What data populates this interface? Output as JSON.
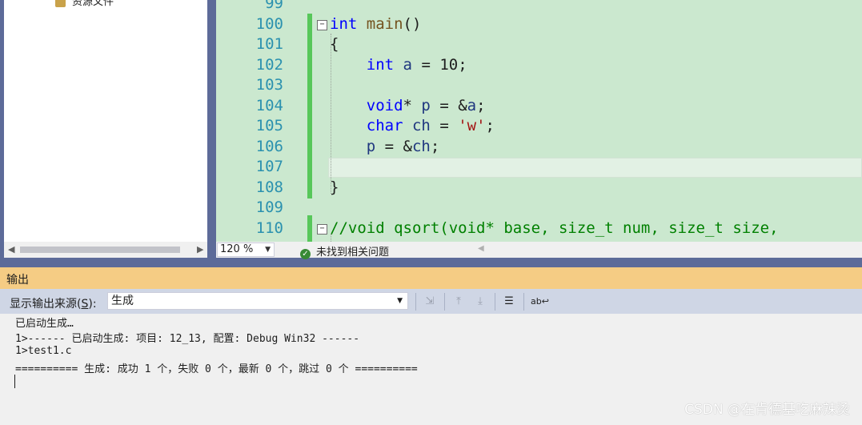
{
  "solution_explorer": {
    "item_label": "资源文件"
  },
  "editor": {
    "lines": [
      {
        "num": "99",
        "segments": []
      },
      {
        "num": "100",
        "segments": [
          {
            "t": "int",
            "c": "kw"
          },
          {
            "t": " "
          },
          {
            "t": "main",
            "c": "fn"
          },
          {
            "t": "()"
          }
        ]
      },
      {
        "num": "101",
        "segments": [
          {
            "t": "{"
          }
        ]
      },
      {
        "num": "102",
        "segments": [
          {
            "t": "    "
          },
          {
            "t": "int",
            "c": "kw"
          },
          {
            "t": " "
          },
          {
            "t": "a",
            "c": "var"
          },
          {
            "t": " = 10;"
          }
        ]
      },
      {
        "num": "103",
        "segments": []
      },
      {
        "num": "104",
        "segments": [
          {
            "t": "    "
          },
          {
            "t": "void",
            "c": "kw"
          },
          {
            "t": "* "
          },
          {
            "t": "p",
            "c": "var"
          },
          {
            "t": " = &"
          },
          {
            "t": "a",
            "c": "var"
          },
          {
            "t": ";"
          }
        ]
      },
      {
        "num": "105",
        "segments": [
          {
            "t": "    "
          },
          {
            "t": "char",
            "c": "kw"
          },
          {
            "t": " "
          },
          {
            "t": "ch",
            "c": "var"
          },
          {
            "t": " = "
          },
          {
            "t": "'w'",
            "c": "str"
          },
          {
            "t": ";"
          }
        ]
      },
      {
        "num": "106",
        "segments": [
          {
            "t": "    "
          },
          {
            "t": "p",
            "c": "var"
          },
          {
            "t": " = &"
          },
          {
            "t": "ch",
            "c": "var"
          },
          {
            "t": ";"
          }
        ]
      },
      {
        "num": "107",
        "segments": []
      },
      {
        "num": "108",
        "segments": [
          {
            "t": "}"
          }
        ]
      },
      {
        "num": "109",
        "segments": []
      },
      {
        "num": "110",
        "segments": [
          {
            "t": "//void qsort(void* base, size_t num, size_t size,",
            "c": "cm"
          }
        ]
      }
    ],
    "fold_symbol": "−"
  },
  "editor_status": {
    "zoom": "120 %",
    "issues_text": "未找到相关问题"
  },
  "output": {
    "title": "输出",
    "source_label_prefix": "显示输出来源(",
    "source_label_key": "S",
    "source_label_suffix": "):",
    "source_value": "生成",
    "lines": [
      "已启动生成…",
      "1>------ 已启动生成: 项目: 12_13, 配置: Debug Win32 ------",
      "1>test1.c",
      "========== 生成: 成功 1 个，失败 0 个，最新 0 个，跳过 0 个 =========="
    ]
  },
  "watermark": "CSDN @在肯德基吃麻辣烫",
  "icons": [
    "folder-icon",
    "scroll-left-icon",
    "scroll-right-icon",
    "check-circle-icon",
    "dropdown-icon",
    "find-in-output-icon",
    "prev-message-icon",
    "next-message-icon",
    "clear-all-icon",
    "word-wrap-icon"
  ],
  "colors": {
    "editor_bg": "#cbe8cf",
    "output_title_bg": "#f5cc84",
    "change_bar": "#57c75a",
    "keyword": "#0000ff",
    "comment": "#008000"
  }
}
